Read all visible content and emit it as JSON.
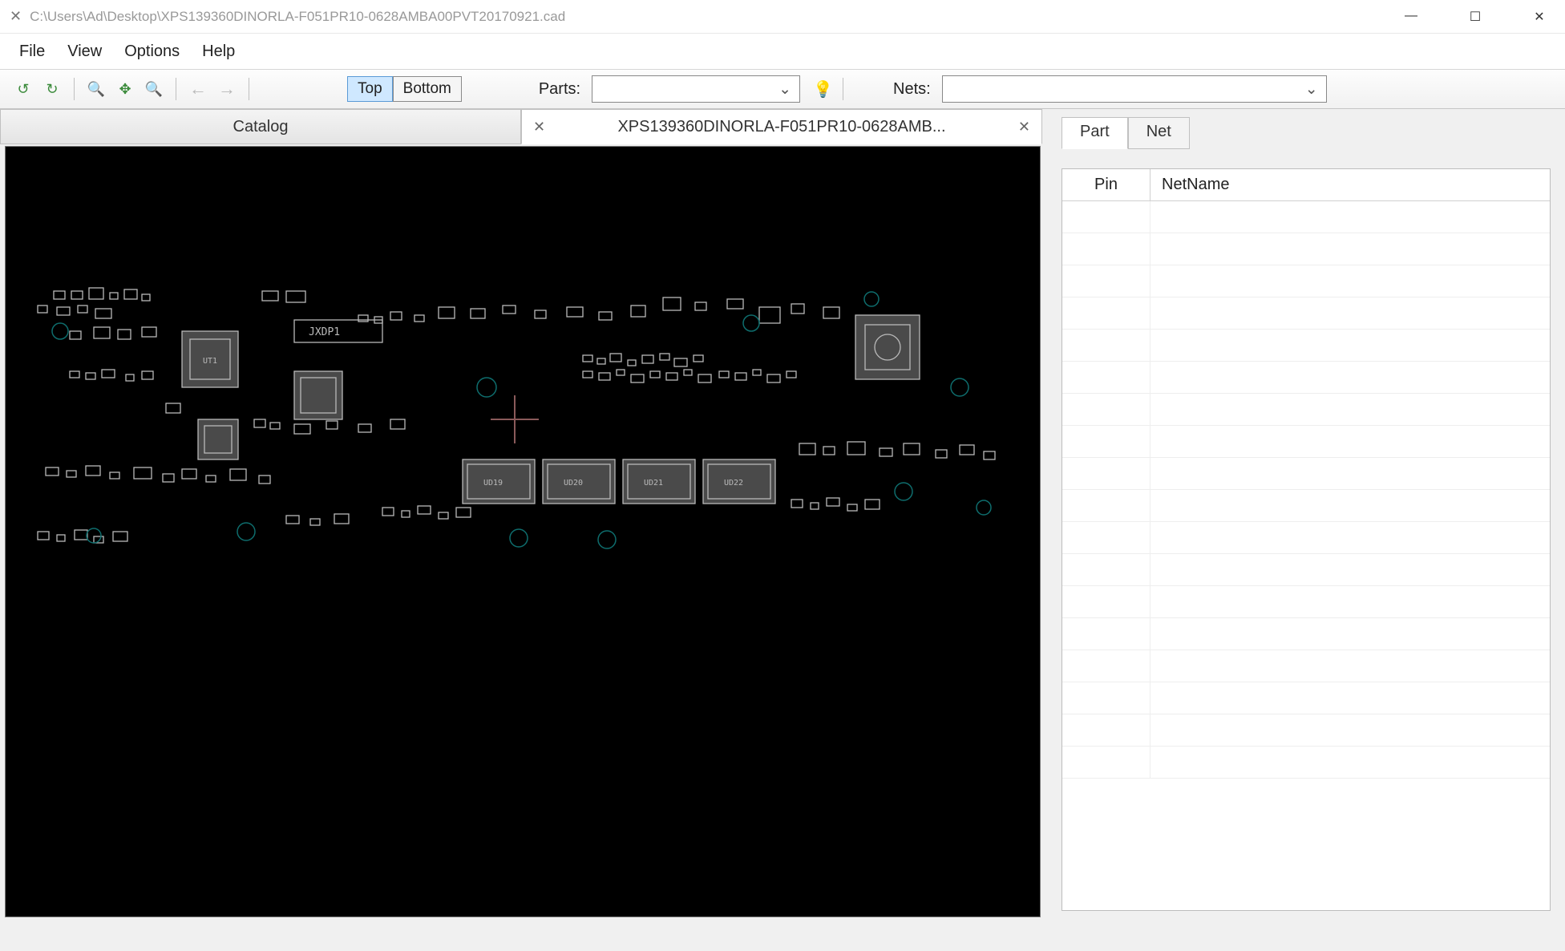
{
  "window": {
    "title": "C:\\Users\\Ad\\Desktop\\XPS139360DINORLA-F051PR10-0628AMBA00PVT20170921.cad"
  },
  "menu": {
    "file": "File",
    "view": "View",
    "options": "Options",
    "help": "Help"
  },
  "toolbar": {
    "top": "Top",
    "bottom": "Bottom",
    "parts_label": "Parts:",
    "parts_value": "",
    "nets_label": "Nets:",
    "nets_value": ""
  },
  "tabs": {
    "catalog": "Catalog",
    "file_tab": "XPS139360DINORLA-F051PR10-0628AMB..."
  },
  "side": {
    "part": "Part",
    "net": "Net",
    "col_pin": "Pin",
    "col_netname": "NetName"
  },
  "board": {
    "jxdp": "JXDP1",
    "ut1": "UT1",
    "ud19": "UD19",
    "ud20": "UD20",
    "ud21": "UD21",
    "ud22": "UD22"
  }
}
